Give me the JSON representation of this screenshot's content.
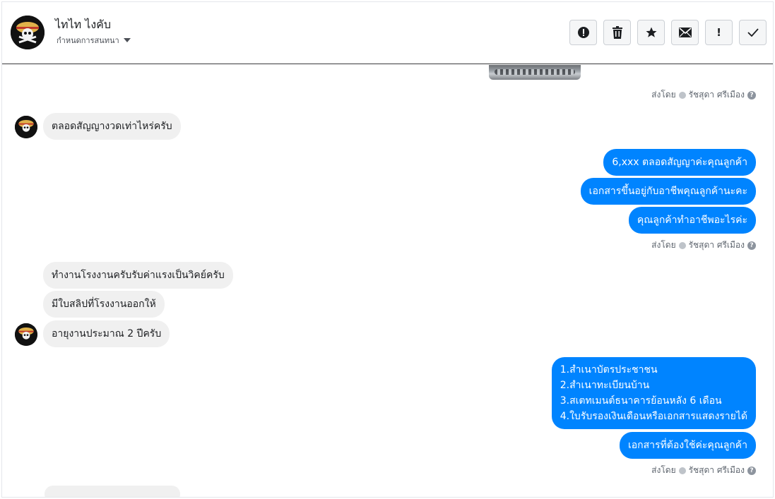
{
  "header": {
    "contact_name": "ไทไท ไงคับ",
    "assign_label": "กำหนดการสนทนา",
    "actions": [
      {
        "name": "report-spam-button",
        "icon": "alert-circle-icon"
      },
      {
        "name": "delete-button",
        "icon": "trash-icon"
      },
      {
        "name": "star-button",
        "icon": "star-icon"
      },
      {
        "name": "mark-unread-button",
        "icon": "envelope-icon"
      },
      {
        "name": "follow-up-button",
        "icon": "exclamation-icon",
        "glyph": "!"
      },
      {
        "name": "mark-done-button",
        "icon": "checkmark-icon"
      }
    ]
  },
  "thread": {
    "sent_by_prefix": "ส่งโดย",
    "agent_name": "รัชสุดา ศรีเมือง",
    "help_glyph": "?",
    "messages": [
      {
        "dir": "in",
        "text": "ตลอดสัญญางวดเท่าไหร่ครับ"
      },
      {
        "dir": "out",
        "text": "6,xxx ตลอดสัญญาค่ะคุณลูกค้า"
      },
      {
        "dir": "out",
        "text": "เอกสารขึ้นอยู่กับอาชีพคุณลูกค้านะคะ"
      },
      {
        "dir": "out",
        "text": "คุณลูกค้าทำอาชีพอะไรค่ะ"
      },
      {
        "dir": "in",
        "text": "ทำงานโรงงานครับรับค่าแรงเป็นวิคย์ครับ"
      },
      {
        "dir": "in",
        "text": "มีใบสลิปที่โรงงานออกให้"
      },
      {
        "dir": "in",
        "text": "อายุงานประมาณ 2 ปีครับ"
      },
      {
        "dir": "out",
        "lines": [
          "1.สำเนาบัตรประชาชน",
          "2.สำเนาทะเบียนบ้าน",
          "3.สเตทเมนต์ธนาคารย้อนหลัง 6 เดือน",
          "4.ใบรับรองเงินเดือนหรือเอกสารแสดงรายได้"
        ]
      },
      {
        "dir": "out",
        "text": "เอกสารที่ต้องใช้ค่ะคุณลูกค้า"
      }
    ]
  },
  "colors": {
    "outgoing_bubble": "#0084ff",
    "incoming_bubble": "#f0f0f0",
    "meta_text": "#606770"
  }
}
